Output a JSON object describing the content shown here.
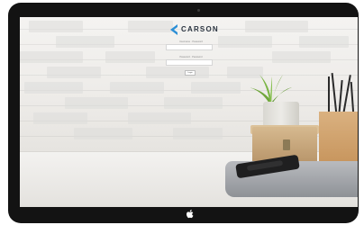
{
  "brand": {
    "logo_text": "CARSON",
    "colors": {
      "logo_blue": "#2c8fd6",
      "logo_dark": "#2b3440"
    }
  },
  "login": {
    "username_label": "Username · Password",
    "password_label": "Password · Password",
    "submit_label": "Login"
  },
  "icons": {
    "device_logo": "apple-logo-icon"
  }
}
